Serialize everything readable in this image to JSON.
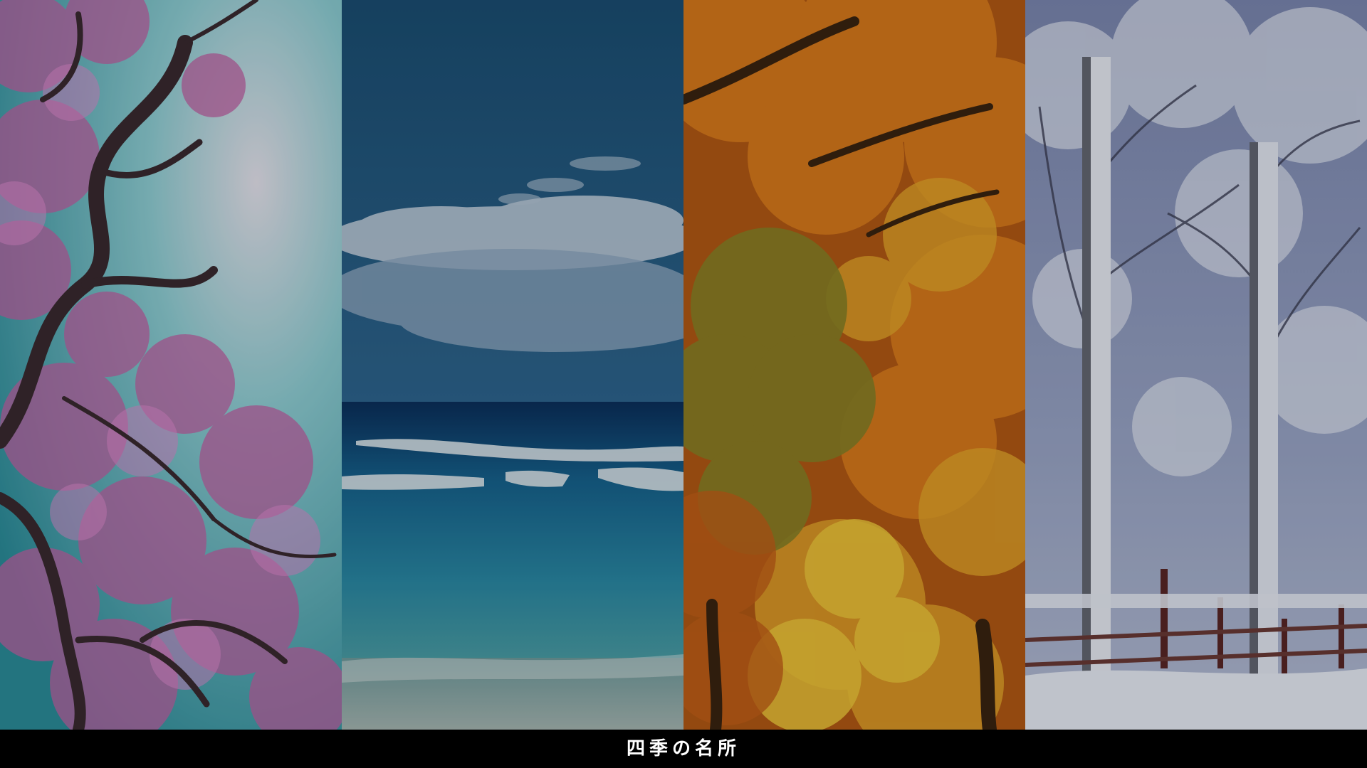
{
  "caption": "四季の名所",
  "panels": [
    {
      "id": "spring",
      "scene": "cherry-blossom-branches",
      "colors": {
        "sky": "#3aa6b0",
        "blossom": "#c86aa8",
        "branch": "#3b2a2e"
      }
    },
    {
      "id": "summer",
      "scene": "ocean-waves",
      "colors": {
        "sky": "#1f5a80",
        "cloud": "#c9d6e2",
        "sea": "#1a6e96",
        "foam": "#e6eef2"
      }
    },
    {
      "id": "autumn",
      "scene": "autumn-maple-trees",
      "colors": {
        "orange": "#d4761c",
        "yellow": "#e2b020",
        "green": "#7a7a22",
        "dark": "#3a2410"
      }
    },
    {
      "id": "winter",
      "scene": "snowy-birch-forest",
      "colors": {
        "sky": "#6f7fa8",
        "snow": "#e8ecf6",
        "trunk": "#2c2f3c",
        "fence": "#5a2a2a"
      }
    }
  ]
}
